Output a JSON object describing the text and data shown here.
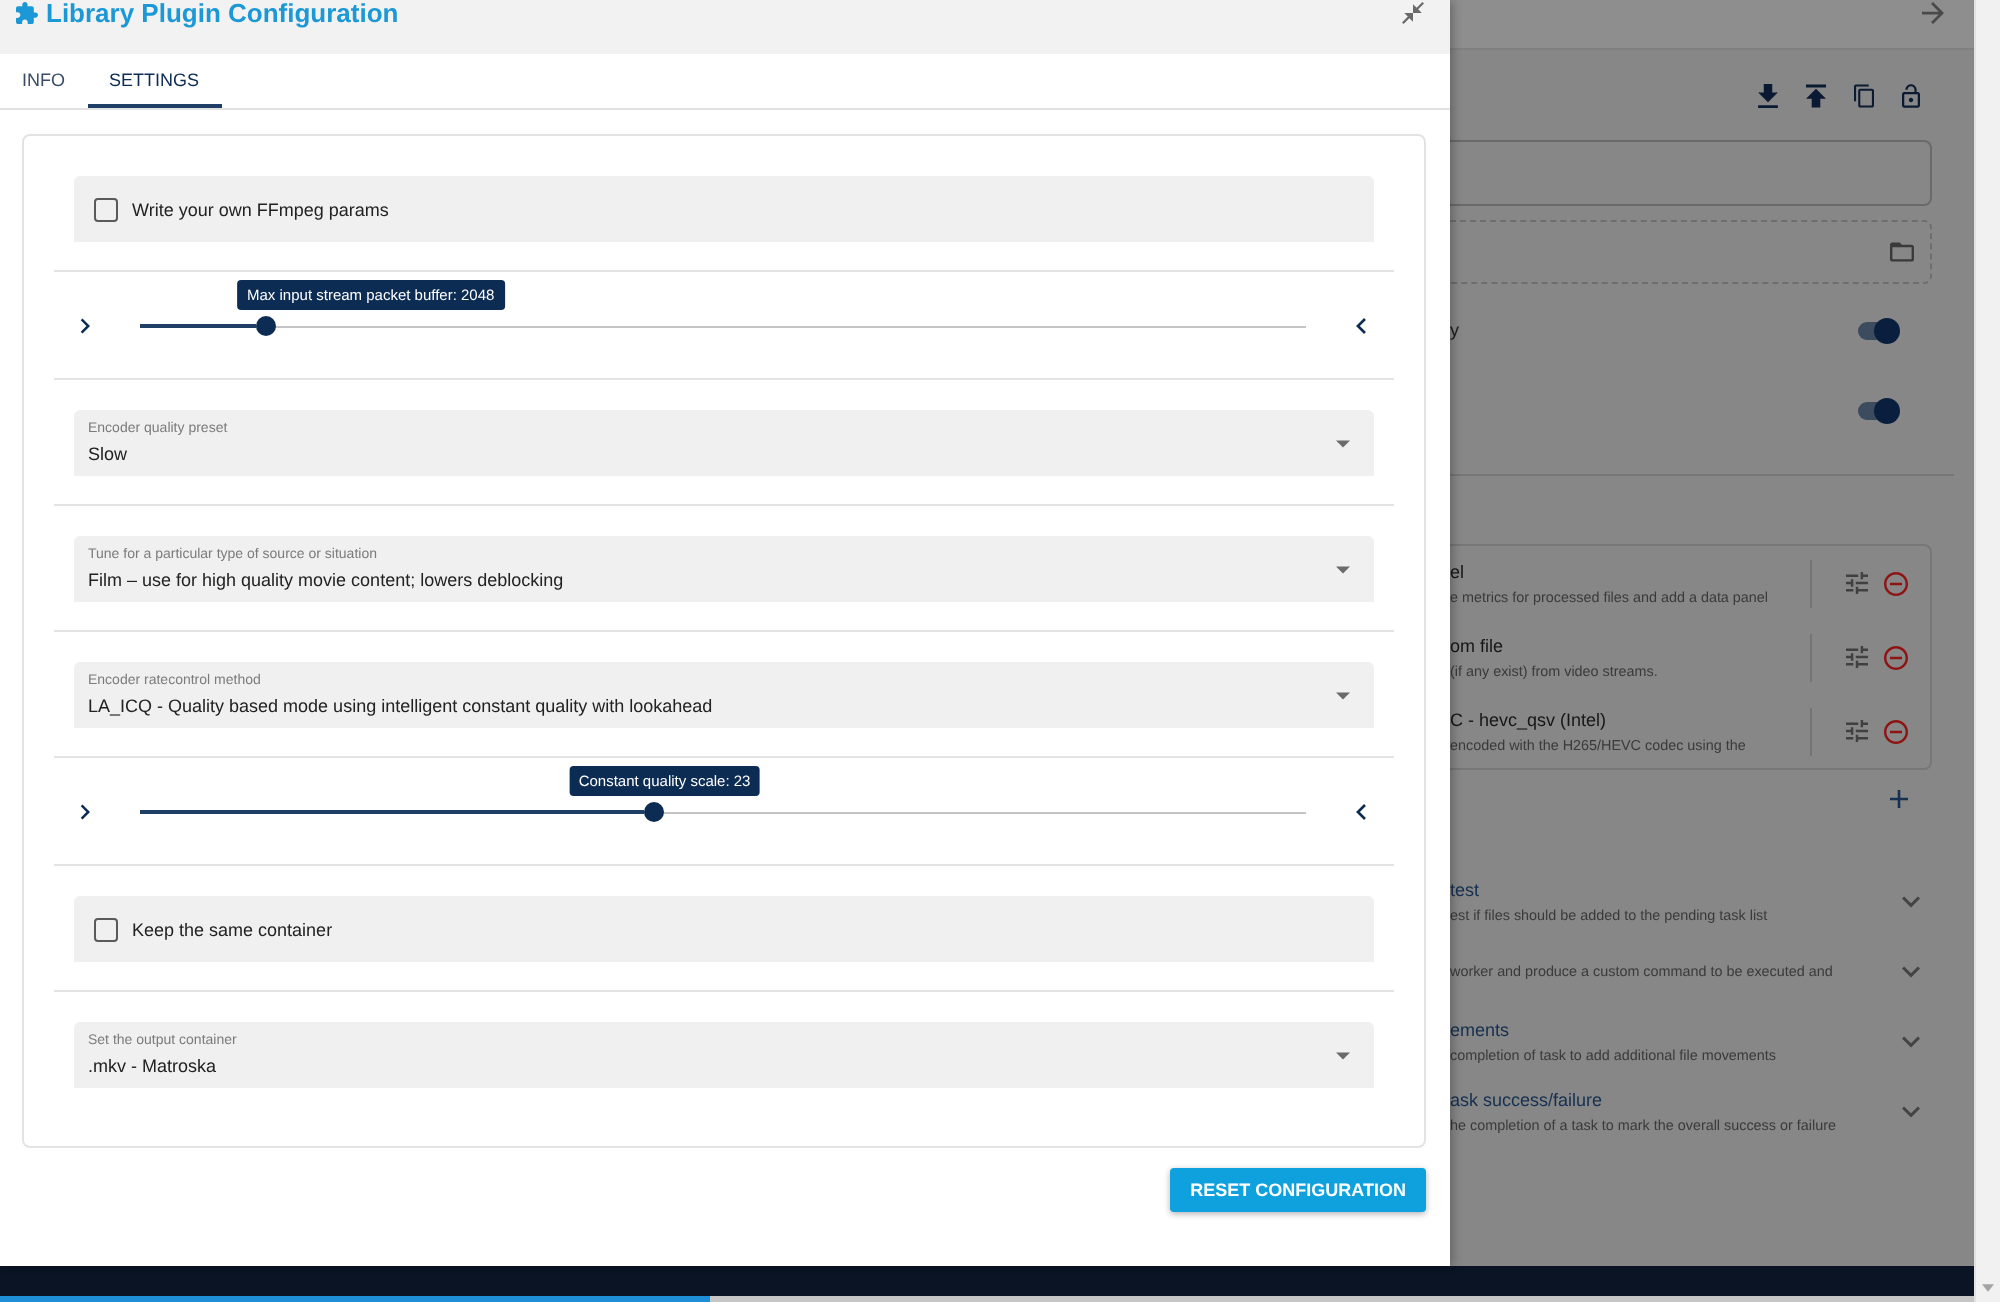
{
  "dialog": {
    "title": "Library Plugin Configuration",
    "tabs": [
      {
        "label": "INFO",
        "selected": false
      },
      {
        "label": "SETTINGS",
        "selected": true
      }
    ],
    "settings": [
      {
        "kind": "checkbox",
        "label": "Write your own FFmpeg params",
        "checked": false
      },
      {
        "kind": "slider",
        "tooltip": "Max input stream packet buffer: 2048",
        "level": 0.108
      },
      {
        "kind": "select",
        "label": "Encoder quality preset",
        "value": "Slow"
      },
      {
        "kind": "select",
        "label": "Tune for a particular type of source or situation",
        "value": "Film – use for high quality movie content; lowers deblocking"
      },
      {
        "kind": "select",
        "label": "Encoder ratecontrol method",
        "value": "LA_ICQ - Quality based mode using intelligent constant quality with lookahead"
      },
      {
        "kind": "slider",
        "tooltip": "Constant quality scale: 23",
        "level": 0.44
      },
      {
        "kind": "checkbox",
        "label": "Keep the same container",
        "checked": false
      },
      {
        "kind": "select",
        "label": "Set the output container",
        "value": ".mkv - Matroska"
      }
    ],
    "reset_button": "RESET CONFIGURATION"
  },
  "background": {
    "toggles": [
      {
        "label": "y",
        "on": true
      },
      {
        "on": true
      }
    ],
    "plugins": [
      {
        "title": "el",
        "description": "e metrics for processed files and add a data panel"
      },
      {
        "title": "om file",
        "description": "(if any exist) from video streams."
      },
      {
        "title": "C - hevc_qsv (Intel)",
        "description": "encoded with the H265/HEVC codec using the"
      }
    ],
    "flow": [
      {
        "title": "test",
        "description": "est if files should be added to the pending task list",
        "expanded": false
      },
      {
        "description": "worker and produce a custom command to be executed and",
        "expanded": false
      },
      {
        "title": "ements",
        "description": "completion of task to add additional file movements",
        "expanded": false
      },
      {
        "title": "ask success/failure",
        "description": "he completion of a task to mark the overall success or failure",
        "expanded": false
      }
    ]
  },
  "bottom_bar": {
    "level": 0.36
  }
}
